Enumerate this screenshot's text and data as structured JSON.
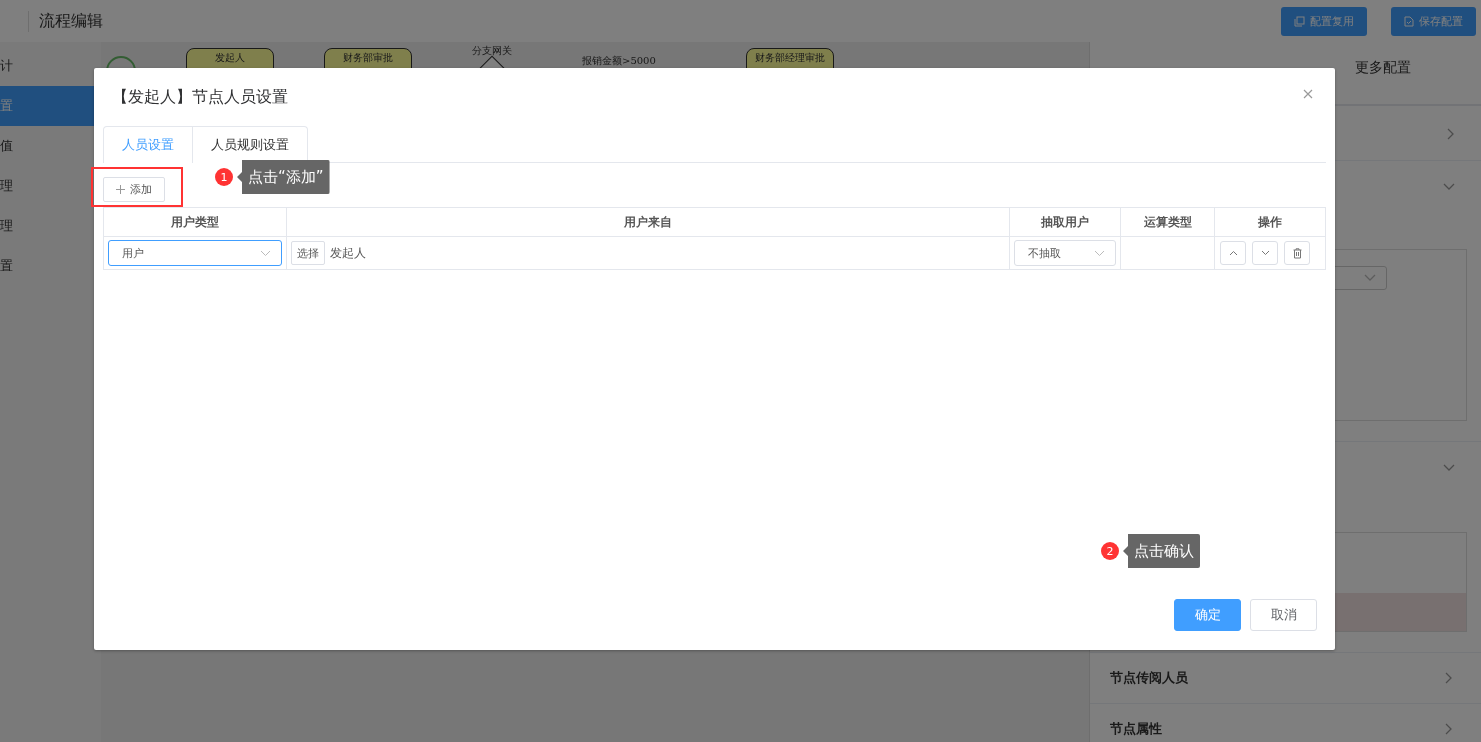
{
  "header": {
    "title": "流程编辑",
    "buttons": [
      {
        "label": "配置复用",
        "kind": "copy"
      },
      {
        "label": "保存配置",
        "kind": "save"
      }
    ]
  },
  "sidebar": {
    "items": [
      {
        "label": "计",
        "selected": false
      },
      {
        "label": "置",
        "selected": true
      },
      {
        "label": "值",
        "selected": false
      },
      {
        "label": "理",
        "selected": false
      },
      {
        "label": "理",
        "selected": false
      },
      {
        "label": "置",
        "selected": false
      }
    ]
  },
  "flow": {
    "nodes": [
      {
        "kind": "start"
      },
      {
        "kind": "task",
        "label": "发起人"
      },
      {
        "kind": "task",
        "label": "财务部审批"
      },
      {
        "kind": "gateway",
        "label": "分支网关"
      },
      {
        "kind": "edge_label",
        "label": "报销金额>5000"
      },
      {
        "kind": "task",
        "label": "财务部经理审批"
      }
    ]
  },
  "right_panel": {
    "tabs": [
      {
        "label": "更多配置",
        "selected": false
      }
    ],
    "sections": [
      {
        "label": "节点传阅人员",
        "expanded": false
      },
      {
        "label": "节点属性",
        "expanded": false
      }
    ]
  },
  "dialog": {
    "title": "【发起人】节点人员设置",
    "tabs": [
      {
        "label": "人员设置",
        "selected": true
      },
      {
        "label": "人员规则设置",
        "selected": false
      }
    ],
    "add_button": "添加",
    "table": {
      "columns": [
        "用户类型",
        "用户来自",
        "抽取用户",
        "运算类型",
        "操作"
      ],
      "rows": [
        {
          "user_type": "用户",
          "select_button": "选择",
          "user_from": "发起人",
          "extract": "不抽取"
        }
      ]
    },
    "buttons": [
      {
        "label": "确定",
        "kind": "primary"
      },
      {
        "label": "取消",
        "kind": "default"
      }
    ]
  },
  "tips": [
    {
      "number": "1",
      "text": "点击“添加”"
    },
    {
      "number": "2",
      "text": "点击确认"
    }
  ]
}
